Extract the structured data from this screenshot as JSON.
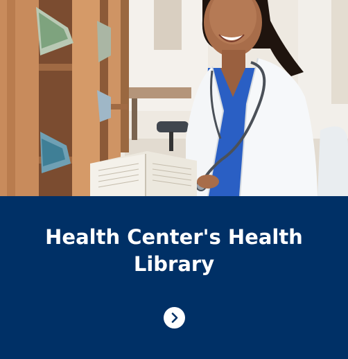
{
  "card": {
    "title": "Health Center's Health Library"
  },
  "link_button": {
    "icon": "chevron-right-icon"
  },
  "colors": {
    "panel_background": "#003066",
    "title_text": "#ffffff",
    "button_background": "#ffffff",
    "button_icon": "#003066"
  }
}
